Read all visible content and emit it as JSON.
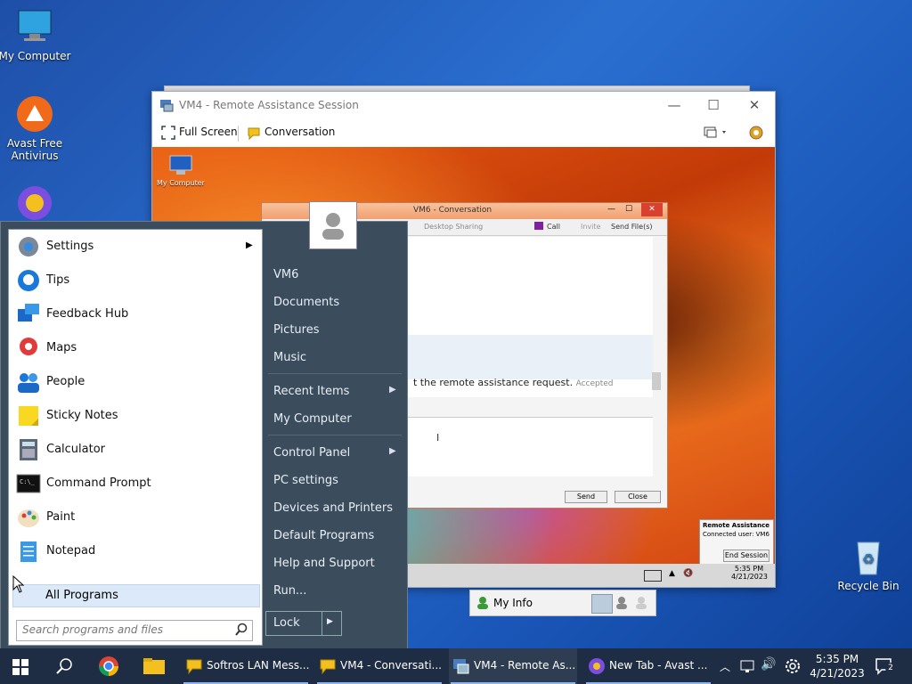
{
  "desktop": {
    "icons": [
      {
        "label": "My Computer"
      },
      {
        "label": "Avast Free Antivirus"
      },
      {
        "label": "Recycle Bin"
      }
    ]
  },
  "ra_window": {
    "title": "VM4 - Remote Assistance Session",
    "toolbar": {
      "full_screen": "Full Screen",
      "conversation": "Conversation"
    },
    "remote": {
      "my_computer_label": "My Computer",
      "conversation": {
        "title": "VM6 - Conversation",
        "tools": {
          "desktop_sharing": "Desktop Sharing",
          "call": "Call",
          "invite": "Invite",
          "send_files": "Send File(s)"
        },
        "message": "t the remote assistance request.",
        "status": "Accepted",
        "send": "Send",
        "close": "Close"
      },
      "notify": {
        "title": "Remote Assistance",
        "connected": "Connected user: VM6",
        "end": "End Session"
      },
      "clock": {
        "time": "5:35 PM",
        "date": "4/21/2023"
      }
    }
  },
  "myinfo": {
    "label": "My Info"
  },
  "start_menu": {
    "left_items": [
      {
        "label": "Settings",
        "icon": "gear-icon"
      },
      {
        "label": "Tips",
        "icon": "lightbulb-icon"
      },
      {
        "label": "Feedback Hub",
        "icon": "feedback-icon"
      },
      {
        "label": "Maps",
        "icon": "map-pin-icon"
      },
      {
        "label": "People",
        "icon": "people-icon"
      },
      {
        "label": "Sticky Notes",
        "icon": "sticky-note-icon"
      },
      {
        "label": "Calculator",
        "icon": "calculator-icon"
      },
      {
        "label": "Command Prompt",
        "icon": "terminal-icon"
      },
      {
        "label": "Paint",
        "icon": "palette-icon"
      },
      {
        "label": "Notepad",
        "icon": "notepad-icon"
      }
    ],
    "all_programs": "All Programs",
    "search_placeholder": "Search programs and files",
    "right_items": [
      "VM6",
      "Documents",
      "Pictures",
      "Music",
      "Recent Items",
      "My Computer",
      "Control Panel",
      "PC settings",
      "Devices and Printers",
      "Default Programs",
      "Help and Support",
      "Run..."
    ],
    "lock": "Lock"
  },
  "taskbar": {
    "apps": [
      "Softros LAN Mess...",
      "VM4 - Conversati...",
      "VM4 - Remote As...",
      "New Tab - Avast ..."
    ],
    "clock": {
      "time": "5:35 PM",
      "date": "4/21/2023"
    },
    "notifications": "2"
  }
}
